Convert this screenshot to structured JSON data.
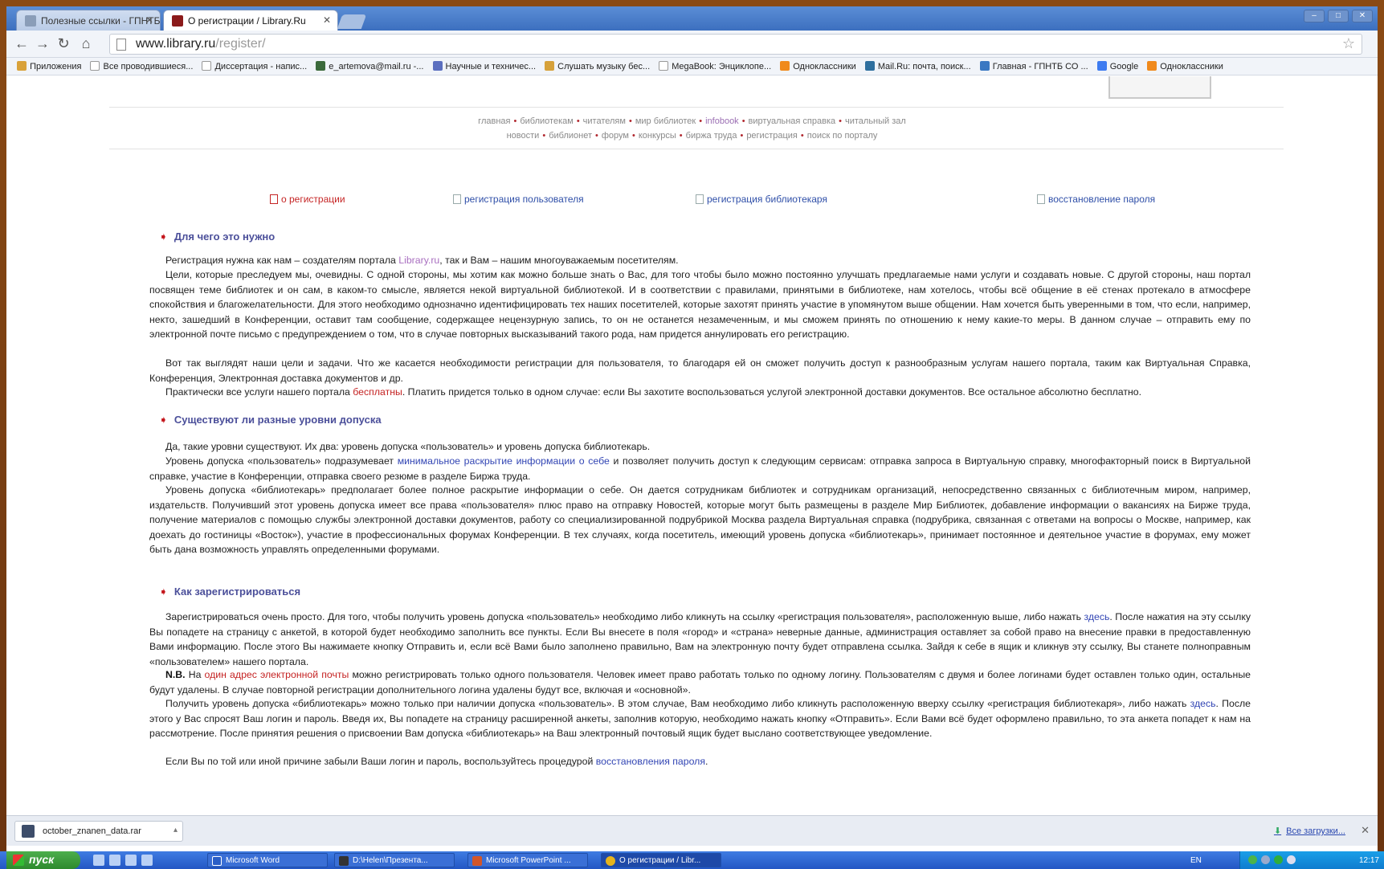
{
  "browser": {
    "tabs": [
      {
        "label": "Полезные ссылки - ГПНТБ",
        "active": false
      },
      {
        "label": "О регистрации / Library.Ru",
        "active": true
      }
    ],
    "url_host": "www.library.ru",
    "url_path": "/register/",
    "bookmarks": [
      "Приложения",
      "Все проводившиеся...",
      "Диссертация - напис...",
      "e_artemova@mail.ru -...",
      "Научные и техничес...",
      "Слушать музыку бес...",
      "MegaBook: Энциклопе...",
      "Одноклассники",
      "Mail.Ru: почта, поиск...",
      "Главная - ГПНТБ СО ...",
      "Google",
      "Одноклассники"
    ]
  },
  "topnav": {
    "row1": [
      "главная",
      "библиотекам",
      "читателям",
      "мир библиотек",
      "infobook",
      "виртуальная справка",
      "читальный зал"
    ],
    "row2": [
      "новости",
      "библионет",
      "форум",
      "конкурсы",
      "биржа труда",
      "регистрация",
      "поиск по порталу"
    ]
  },
  "regnav": {
    "about": "о регистрации",
    "user": "регистрация пользователя",
    "librarian": "регистрация библиотекаря",
    "restore": "восстановление пароля"
  },
  "sections": {
    "why": {
      "title": "Для чего это нужно",
      "p1_a": "Регистрация нужна как нам – создателям портала ",
      "p1_link": "Library.ru",
      "p1_b": ", так и Вам – нашим многоуважаемым посетителям.",
      "p2": "Цели, которые преследуем мы, очевидны. С одной стороны, мы хотим как можно больше знать о Вас, для того чтобы было можно постоянно улучшать предлагаемые нами услуги и создавать новые. С другой стороны, наш портал посвящен теме библиотек и он сам, в каком-то смысле, является некой виртуальной библиотекой. И в соответствии с правилами, принятыми в библиотеке, нам хотелось, чтобы всё общение в её стенах протекало в атмосфере спокойствия и благожелательности. Для этого необходимо однозначно идентифицировать тех наших посетителей, которые захотят принять участие в упомянутом выше общении. Нам хочется быть уверенными в том, что если, например, некто, зашедший в Конференции, оставит там сообщение, содержащее нецензурную запись, то он не останется незамеченным, и мы сможем принять по отношению к нему какие-то меры. В данном случае – отправить ему по электронной почте письмо с предупреждением о том, что в случае повторных высказываний такого рода, нам придется аннулировать его регистрацию.",
      "p3": "Вот так выглядят наши цели и задачи. Что же касается необходимости регистрации для пользователя, то благодаря ей он сможет получить доступ к разнообразным услугам нашего портала, таким как Виртуальная Справка, Конференция, Электронная доставка документов и др.",
      "p4_a": "Практически все услуги нашего портала ",
      "p4_link": "бесплатны",
      "p4_b": ". Платить придется только в одном случае: если Вы захотите воспользоваться услугой электронной доставки документов. Все остальное абсолютно бесплатно."
    },
    "levels": {
      "title": "Существуют ли разные уровни допуска",
      "p1": "Да, такие уровни существуют. Их два: уровень допуска «пользователь» и уровень допуска библиотекарь.",
      "p2_a": "Уровень допуска «пользователь» подразумевает ",
      "p2_link": "минимальное раскрытие информации о себе",
      "p2_b": " и позволяет получить доступ к следующим сервисам: отправка запроса в Виртуальную справку, многофакторный поиск в Виртуальной справке, участие в Конференции, отправка своего резюме в разделе Биржа труда.",
      "p3": "Уровень допуска «библиотекарь» предполагает более полное раскрытие информации о себе. Он дается сотрудникам библиотек и сотрудникам организаций, непосредственно связанных с библиотечным миром, например, издательств. Получивший этот уровень допуска имеет все права «пользователя» плюс право на отправку Новостей, которые могут быть размещены в разделе Мир Библиотек, добавление информации о вакансиях на Бирже труда, получение материалов с помощью службы электронной доставки документов, работу со специализированной подрубрикой Москва раздела Виртуальная справка (подрубрика, связанная с ответами на вопросы о Москве, например, как доехать до гостиницы «Восток»), участие в профессиональных форумах Конференции. В тех случаях, когда посетитель, имеющий уровень допуска «библиотекарь», принимает постоянное и деятельное участие в форумах, ему может быть дана возможность управлять определенными форумами."
    },
    "how": {
      "title": "Как зарегистрироваться",
      "p1_a": "Зарегистрироваться очень просто. Для того, чтобы получить уровень допуска «пользователь» необходимо либо кликнуть на ссылку «регистрация пользователя», расположенную выше, либо нажать ",
      "p1_link": "здесь",
      "p1_b": ". После нажатия на эту ссылку Вы попадете на страницу с анкетой, в которой будет необходимо заполнить все пункты. Если Вы внесете в поля «город» и «страна» неверные данные, администрация оставляет за собой право на внесение правки в предоставленную Вами информацию. После этого Вы нажимаете кнопку Отправить и, если всё Вами было заполнено правильно, Вам на электронную почту будет отправлена ссылка. Зайдя к себе в ящик и кликнув эту ссылку, Вы станете полноправным «пользователем» нашего портала.",
      "p2_bold": "N.B.",
      "p2_a": " На ",
      "p2_link": "один адрес электронной почты",
      "p2_b": " можно регистрировать только одного пользователя. Человек имеет право работать только по одному логину. Пользователям с двумя и более логинами будет оставлен только один, остальные будут удалены. В случае повторной регистрации дополнительного логина удалены будут все, включая и «основной».",
      "p3_a": "Получить уровень допуска «библиотекарь» можно только при наличии допуска «пользователь». В этом случае, Вам необходимо либо кликнуть расположенную вверху ссылку «регистрация библиотекаря», либо нажать ",
      "p3_link": "здесь",
      "p3_b": ". После этого у Вас спросят Ваш логин и пароль. Введя их, Вы попадете на страницу расширенной анкеты, заполнив которую, необходимо нажать кнопку «Отправить». Если Вами всё будет оформлено правильно, то эта анкета попадет к нам на рассмотрение. После принятия решения о присвоении Вам допуска «библиотекарь» на Ваш электронный почтовый ящик будет выслано соответствующее уведомление.",
      "p4_a": "Если Вы по той или иной причине забыли Ваши логин и пароль, воспользуйтесь процедурой ",
      "p4_link": "восстановления пароля",
      "p4_b": "."
    }
  },
  "downloads": {
    "file": "october_znanen_data.rar",
    "all_label": "Все загрузки..."
  },
  "taskbar": {
    "start": "пуск",
    "windows": [
      {
        "label": "Microsoft Word",
        "active": false
      },
      {
        "label": "D:\\Helen\\Презента...",
        "active": false
      },
      {
        "label": "Microsoft PowerPoint ...",
        "active": false
      },
      {
        "label": "О регистрации / Libr...",
        "active": true
      }
    ],
    "lang": "EN",
    "clock": "12:17"
  },
  "colors": {
    "accent_link": "#3346b4",
    "accent_red": "#c52424",
    "heading": "#4b4f9a"
  }
}
